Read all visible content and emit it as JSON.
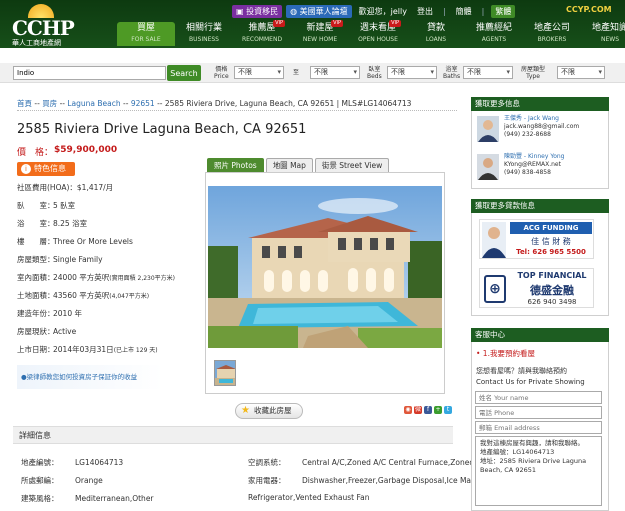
{
  "header": {
    "logo_text": "CCHP",
    "logo_sub": "華人工商地產網",
    "top_links": {
      "immigration": "投資移民",
      "forum": "美國華人論壇",
      "welcome": "歡迎您，jelly",
      "logout": "登出",
      "simplified": "簡體",
      "traditional": "繁體",
      "site": "CCYP.COM"
    },
    "nav": [
      {
        "zh": "買屋",
        "en": "FOR SALE"
      },
      {
        "zh": "相關行業",
        "en": "BUSINESS"
      },
      {
        "zh": "推薦屋",
        "en": "RECOMMEND"
      },
      {
        "zh": "新建屋",
        "en": "NEW HOME"
      },
      {
        "zh": "週末看屋",
        "en": "OPEN HOUSE"
      },
      {
        "zh": "貸款",
        "en": "LOANS"
      },
      {
        "zh": "推薦經紀",
        "en": "AGENTS"
      },
      {
        "zh": "地產公司",
        "en": "BROKERS"
      },
      {
        "zh": "地產知識",
        "en": "NEWS"
      }
    ],
    "vip": "VIP"
  },
  "search": {
    "value": "Indio",
    "button": "Search",
    "price_zh": "價格",
    "price_en": "Price",
    "to": "至",
    "beds_zh": "臥室",
    "beds_en": "Beds",
    "baths_zh": "浴室",
    "baths_en": "Baths",
    "type_zh": "房屋類型",
    "type_en": "Type",
    "any": "不限"
  },
  "breadcrumb": {
    "home": "首頁",
    "buy": "買房",
    "city": "Laguna Beach",
    "zip": "92651",
    "current": "2585 Riviera Drive, Laguna Beach, CA 92651 | MLS#LG14064713",
    "sep": " -- "
  },
  "listing": {
    "title": "2585 Riviera Drive Laguna Beach, CA 92651",
    "price_label": "價　格：",
    "price": "$59,900,000",
    "feature": "特色信息",
    "details": [
      {
        "k": "社區費用(HOA)：",
        "v": "$1,417/月",
        "note": ""
      },
      {
        "k": "臥　　室：",
        "v": "5 臥室",
        "note": ""
      },
      {
        "k": "浴　　室：",
        "v": "8.25 浴室",
        "note": ""
      },
      {
        "k": "樓　　層：",
        "v": "Three Or More Levels",
        "note": ""
      },
      {
        "k": "房屋類型：",
        "v": "Single Family",
        "note": ""
      },
      {
        "k": "室內面積：",
        "v": "24000 平方英呎",
        "note": "(實用面積 2,230平方米)"
      },
      {
        "k": "土地面積：",
        "v": "43560 平方英呎",
        "note": "(4,047平方米)"
      },
      {
        "k": "建造年份：",
        "v": "2010 年",
        "note": ""
      },
      {
        "k": "房屋現狀：",
        "v": "Active",
        "note": ""
      },
      {
        "k": "上市日期：",
        "v": "2014年03月31日",
        "note": "(已上市 129 天)"
      }
    ],
    "promo": "●梁律師教您如何投資房子保証你的收益"
  },
  "photo_tabs": [
    "照片 Photos",
    "地圖 Map",
    "街景 Street View"
  ],
  "save": "收藏此房屋",
  "info": {
    "title": "詳細信息",
    "left": [
      {
        "k": "地產編號：",
        "v": "LG14064713"
      },
      {
        "k": "所處郵編：",
        "v": "Orange"
      },
      {
        "k": "建築風格：",
        "v": "Mediterranean,Other"
      }
    ],
    "right": [
      {
        "k": "空調系統：",
        "v": "Central A/C,Zoned A/C Central Furnace,Zoned"
      },
      {
        "k": "家用電器：",
        "v": "Dishwasher,Freezer,Garbage Disposal,Ice Maker,"
      },
      {
        "k": "",
        "v": "Refrigerator,Vented Exhaust Fan"
      }
    ]
  },
  "sidebar": {
    "more_info": "獲取更多信息",
    "agents": [
      {
        "name": "王傑秀 - Jack Wang",
        "email": "jack.wang88@gmail.com",
        "phone": "(949) 232-8688"
      },
      {
        "name": "陳勁豐 - Kinney Yong",
        "email": "KYong@REMAX.net",
        "phone": "(949) 838-4858"
      }
    ],
    "loan_info": "獲取更多貸款信息",
    "ad1": {
      "brand": "ACG FUNDING",
      "zh": "佳 信 財 務",
      "tel": "Tel: 626 965 5500"
    },
    "ad2": {
      "brand": "TOP FINANCIAL",
      "zh": "德盛金融",
      "tel": "626 940 3498"
    },
    "client": "客服中心",
    "appointment": "• 1.我要預約看屋",
    "want": "您想看屋嗎？請與我聯絡預約",
    "contact": "Contact Us for Private Showing",
    "name_ph": "姓名 Your name",
    "phone_ph": "電話 Phone",
    "email_ph": "郵箱 Email address",
    "message": "我對這棟房屋有興趣，請和我聯絡。\n地產編號：LG14064713\n地址：2585 Riviera Drive Laguna Beach, CA 92651"
  }
}
